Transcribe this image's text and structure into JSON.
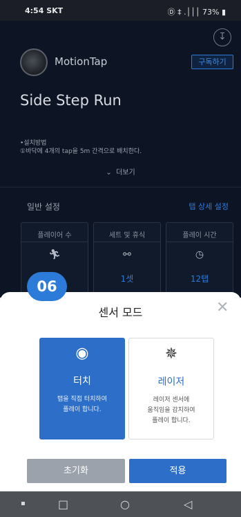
{
  "status_bar": {
    "time": "4:54",
    "carrier": "SKT",
    "icons_text": "Ⓓ ‡ .│││ 73% ▮"
  },
  "app": {
    "brand_name": "MotionTap",
    "subscribe_label": "구독하기",
    "title": "Side Step Run",
    "desc_line1": "•설치방법",
    "desc_line2": "①바닥에 4개의 tap을 5m 간격으로 배치한다.",
    "more_label": "더보기",
    "settings_title": "일반 설정",
    "settings_link": "탭 상세 설정",
    "cards": [
      {
        "label": "플레이어 수",
        "icon": "runner-icon",
        "glyph": "🏃︎",
        "value": ""
      },
      {
        "label": "세트 및 휴식",
        "icon": "link-icon",
        "glyph": "⚯",
        "value": "1셋"
      },
      {
        "label": "플레이 시간",
        "icon": "clock-icon",
        "glyph": "◷",
        "value": "12탭"
      }
    ]
  },
  "badge": "06",
  "sheet": {
    "title": "센서 모드",
    "modes": [
      {
        "name": "터치",
        "icon": "radio-target-icon",
        "glyph": "◉",
        "desc": [
          "탭을 직접 터치하여",
          "플레이 합니다."
        ],
        "selected": true
      },
      {
        "name": "레이저",
        "icon": "magic-wand-icon",
        "glyph": "✵",
        "desc": [
          "레이저 센서에",
          "움직임을 감지하여",
          "플레이 합니다."
        ],
        "selected": false
      }
    ],
    "reset_label": "초기화",
    "apply_label": "적용"
  },
  "colors": {
    "accent": "#2d6fc8",
    "app_bg": "#0d1524",
    "reset_btn": "#9ba2ab"
  }
}
